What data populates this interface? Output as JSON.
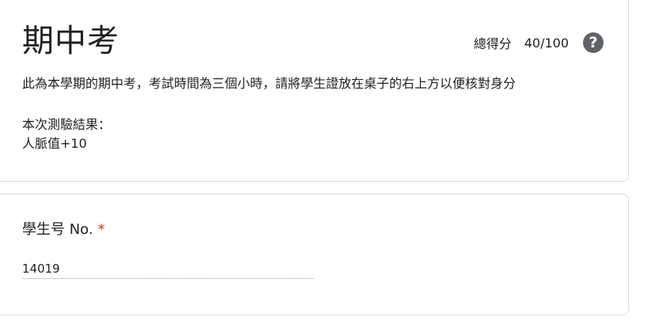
{
  "header": {
    "title": "期中考",
    "score_label": "總得分",
    "score_value": "40/100",
    "help_icon": "question-mark-icon",
    "help_glyph": "?",
    "description": "此為本學期的期中考，考試時間為三個小時，請將學生證放在桌子的右上方以便核對身分",
    "result_title": "本次測驗結果：",
    "result_value": "人脈值+10"
  },
  "question": {
    "title": "學生号 No.",
    "required_marker": "*",
    "answer": "14019"
  },
  "colors": {
    "required": "#d93025",
    "help_icon_bg": "#5f6368",
    "border": "#dadce0"
  }
}
